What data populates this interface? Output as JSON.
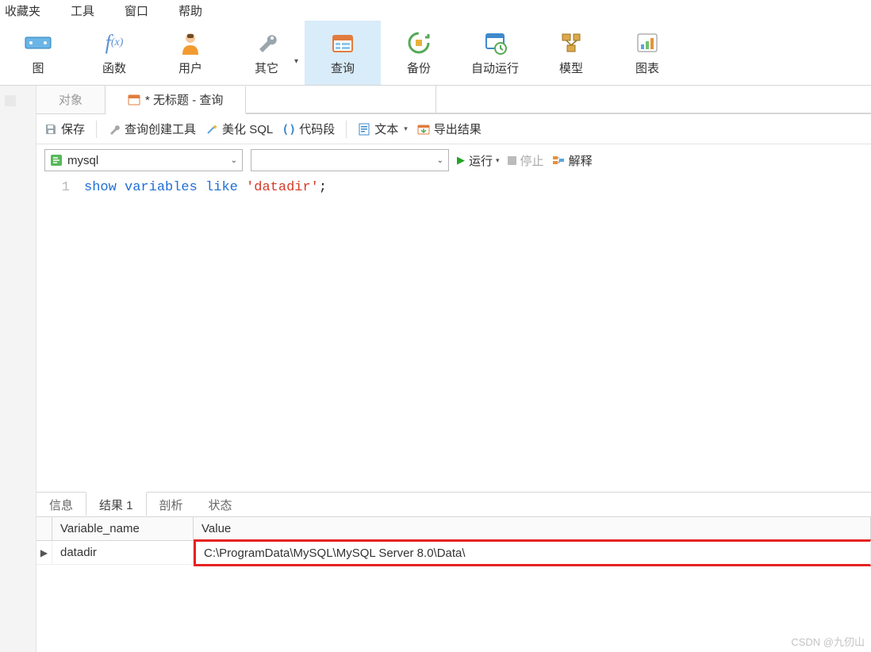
{
  "menubar": {
    "favorites": "收藏夹",
    "tools": "工具",
    "window": "窗口",
    "help": "帮助"
  },
  "bigtoolbar": {
    "view": {
      "label": "图"
    },
    "func": {
      "label": "函数"
    },
    "user": {
      "label": "用户"
    },
    "other": {
      "label": "其它"
    },
    "query": {
      "label": "查询"
    },
    "backup": {
      "label": "备份"
    },
    "auto": {
      "label": "自动运行"
    },
    "model": {
      "label": "模型"
    },
    "chart": {
      "label": "图表"
    }
  },
  "tabs": {
    "objects": "对象",
    "untitled": "* 无标题 - 查询"
  },
  "smalltool": {
    "save": "保存",
    "querybuilder": "查询创建工具",
    "beautify": "美化 SQL",
    "snippet": "代码段",
    "text": "文本",
    "export": "导出结果"
  },
  "conn": {
    "selected": "mysql"
  },
  "run": {
    "run": "运行",
    "stop": "停止",
    "explain": "解释"
  },
  "editor": {
    "lineno": "1",
    "kw_show": "show",
    "kw_variables": "variables",
    "kw_like": "like",
    "literal": "'datadir'",
    "semicolon": ";"
  },
  "resulttabs": {
    "info": "信息",
    "result1": "结果 1",
    "profile": "剖析",
    "status": "状态"
  },
  "result": {
    "headers": {
      "name": "Variable_name",
      "value": "Value"
    },
    "row": {
      "name": "datadir",
      "value": "C:\\ProgramData\\MySQL\\MySQL Server 8.0\\Data\\"
    }
  },
  "watermark": "CSDN @九仞山"
}
